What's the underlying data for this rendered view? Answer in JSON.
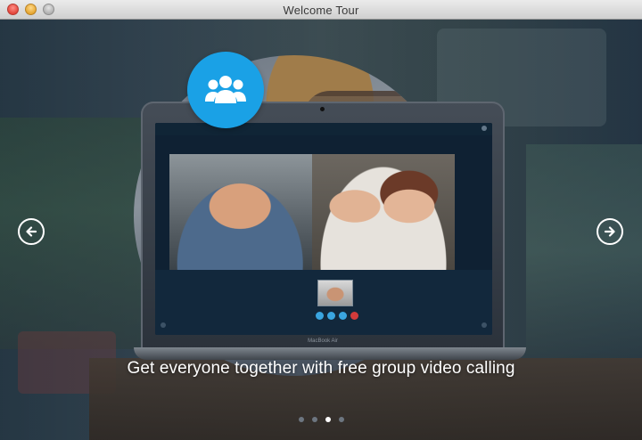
{
  "window": {
    "title": "Welcome Tour"
  },
  "slide": {
    "caption": "Get everyone together with free group video calling",
    "badge_icon": "group-users-icon",
    "laptop_brand": "MacBook Air",
    "accent_color": "#1aa1e6"
  },
  "navigation": {
    "prev_icon": "arrow-left-icon",
    "next_icon": "arrow-right-icon"
  },
  "pagination": {
    "total": 4,
    "current": 3
  }
}
